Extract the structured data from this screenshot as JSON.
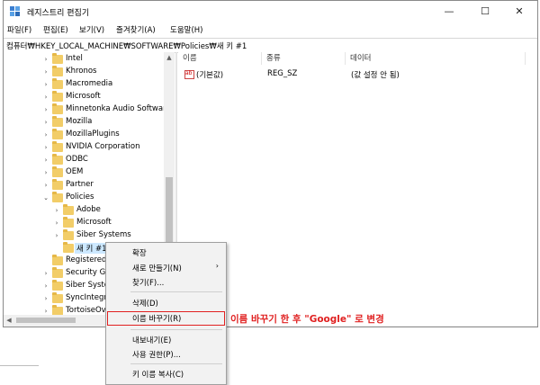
{
  "window": {
    "title": "레지스트리 편집기",
    "controls": {
      "minimize": "—",
      "maximize": "☐",
      "close": "✕"
    }
  },
  "menu": [
    "파일(F)",
    "편집(E)",
    "보기(V)",
    "즐겨찾기(A)",
    "도움말(H)"
  ],
  "address": "컴퓨터₩HKEY_LOCAL_MACHINE₩SOFTWARE₩Policies₩새 키 #1",
  "tree": [
    {
      "label": "Intel",
      "arrow": "›"
    },
    {
      "label": "Khronos",
      "arrow": "›"
    },
    {
      "label": "Macromedia",
      "arrow": "›"
    },
    {
      "label": "Microsoft",
      "arrow": "›"
    },
    {
      "label": "Minnetonka Audio Software",
      "arrow": "›"
    },
    {
      "label": "Mozilla",
      "arrow": "›"
    },
    {
      "label": "MozillaPlugins",
      "arrow": "›"
    },
    {
      "label": "NVIDIA Corporation",
      "arrow": "›"
    },
    {
      "label": "ODBC",
      "arrow": "›"
    },
    {
      "label": "OEM",
      "arrow": "›"
    },
    {
      "label": "Partner",
      "arrow": "›"
    },
    {
      "label": "Policies",
      "arrow": "⌄"
    },
    {
      "label": "Adobe",
      "arrow": "›"
    },
    {
      "label": "Microsoft",
      "arrow": "›"
    },
    {
      "label": "Siber Systems",
      "arrow": "›"
    },
    {
      "label": "새 키 #1",
      "arrow": ""
    },
    {
      "label": "RegisteredApplications",
      "arrow": ""
    },
    {
      "label": "Security Global",
      "arrow": "›"
    },
    {
      "label": "Siber Systems",
      "arrow": "›"
    },
    {
      "label": "SyncIntegration",
      "arrow": "›"
    },
    {
      "label": "TortoiseOverlays",
      "arrow": "›"
    }
  ],
  "columns": {
    "name": "이름",
    "type": "종류",
    "data": "데이터"
  },
  "value_row": {
    "name": "(기본값)",
    "type": "REG_SZ",
    "data": "(값 설정 안 됨)"
  },
  "context_menu": {
    "expand": "확장",
    "new": "새로 만들기(N)",
    "new_arrow": "›",
    "find": "찾기(F)...",
    "delete": "삭제(D)",
    "rename": "이름 바꾸기(R)",
    "export": "내보내기(E)",
    "permissions": "사용 권한(P)...",
    "copy_key_name": "키 이름 복사(C)"
  },
  "annotation": "이름 바꾸기 한 후 \"Google\" 로 변경",
  "colors": {
    "folder": "#f2cd68",
    "highlight": "#e12020",
    "selection": "#cce8ff"
  }
}
